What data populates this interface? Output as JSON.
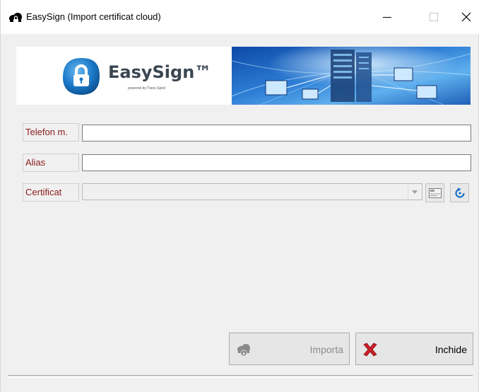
{
  "window": {
    "title": "EasySign (Import certificat cloud)",
    "icon": "cloud-lock-icon",
    "controls": {
      "minimize": "minimize-icon",
      "maximize": "maximize-icon",
      "close": "close-icon"
    }
  },
  "banner": {
    "logo_text": "EasySign™",
    "logo_subtitle": "powered by Trans Sped"
  },
  "form": {
    "telefon": {
      "label": "Telefon m.",
      "value": "",
      "placeholder": ""
    },
    "alias": {
      "label": "Alias",
      "value": "",
      "placeholder": ""
    },
    "certificat": {
      "label": "Certificat",
      "value": "",
      "dropdown_icon": "chevron-down-icon",
      "view_icon": "certificate-view-icon",
      "refresh_icon": "refresh-icon"
    }
  },
  "buttons": {
    "importa": {
      "label": "Importa",
      "icon": "cloud-download-icon",
      "enabled": false
    },
    "inchide": {
      "label": "Inchide",
      "icon": "close-x-icon",
      "enabled": true
    }
  },
  "colors": {
    "label_text": "#8b1c1c",
    "disabled_text": "#8c8c8c",
    "close_x": "#cc1f2a",
    "logo_blue": "#1b79c8",
    "refresh_blue": "#1c73c9"
  }
}
